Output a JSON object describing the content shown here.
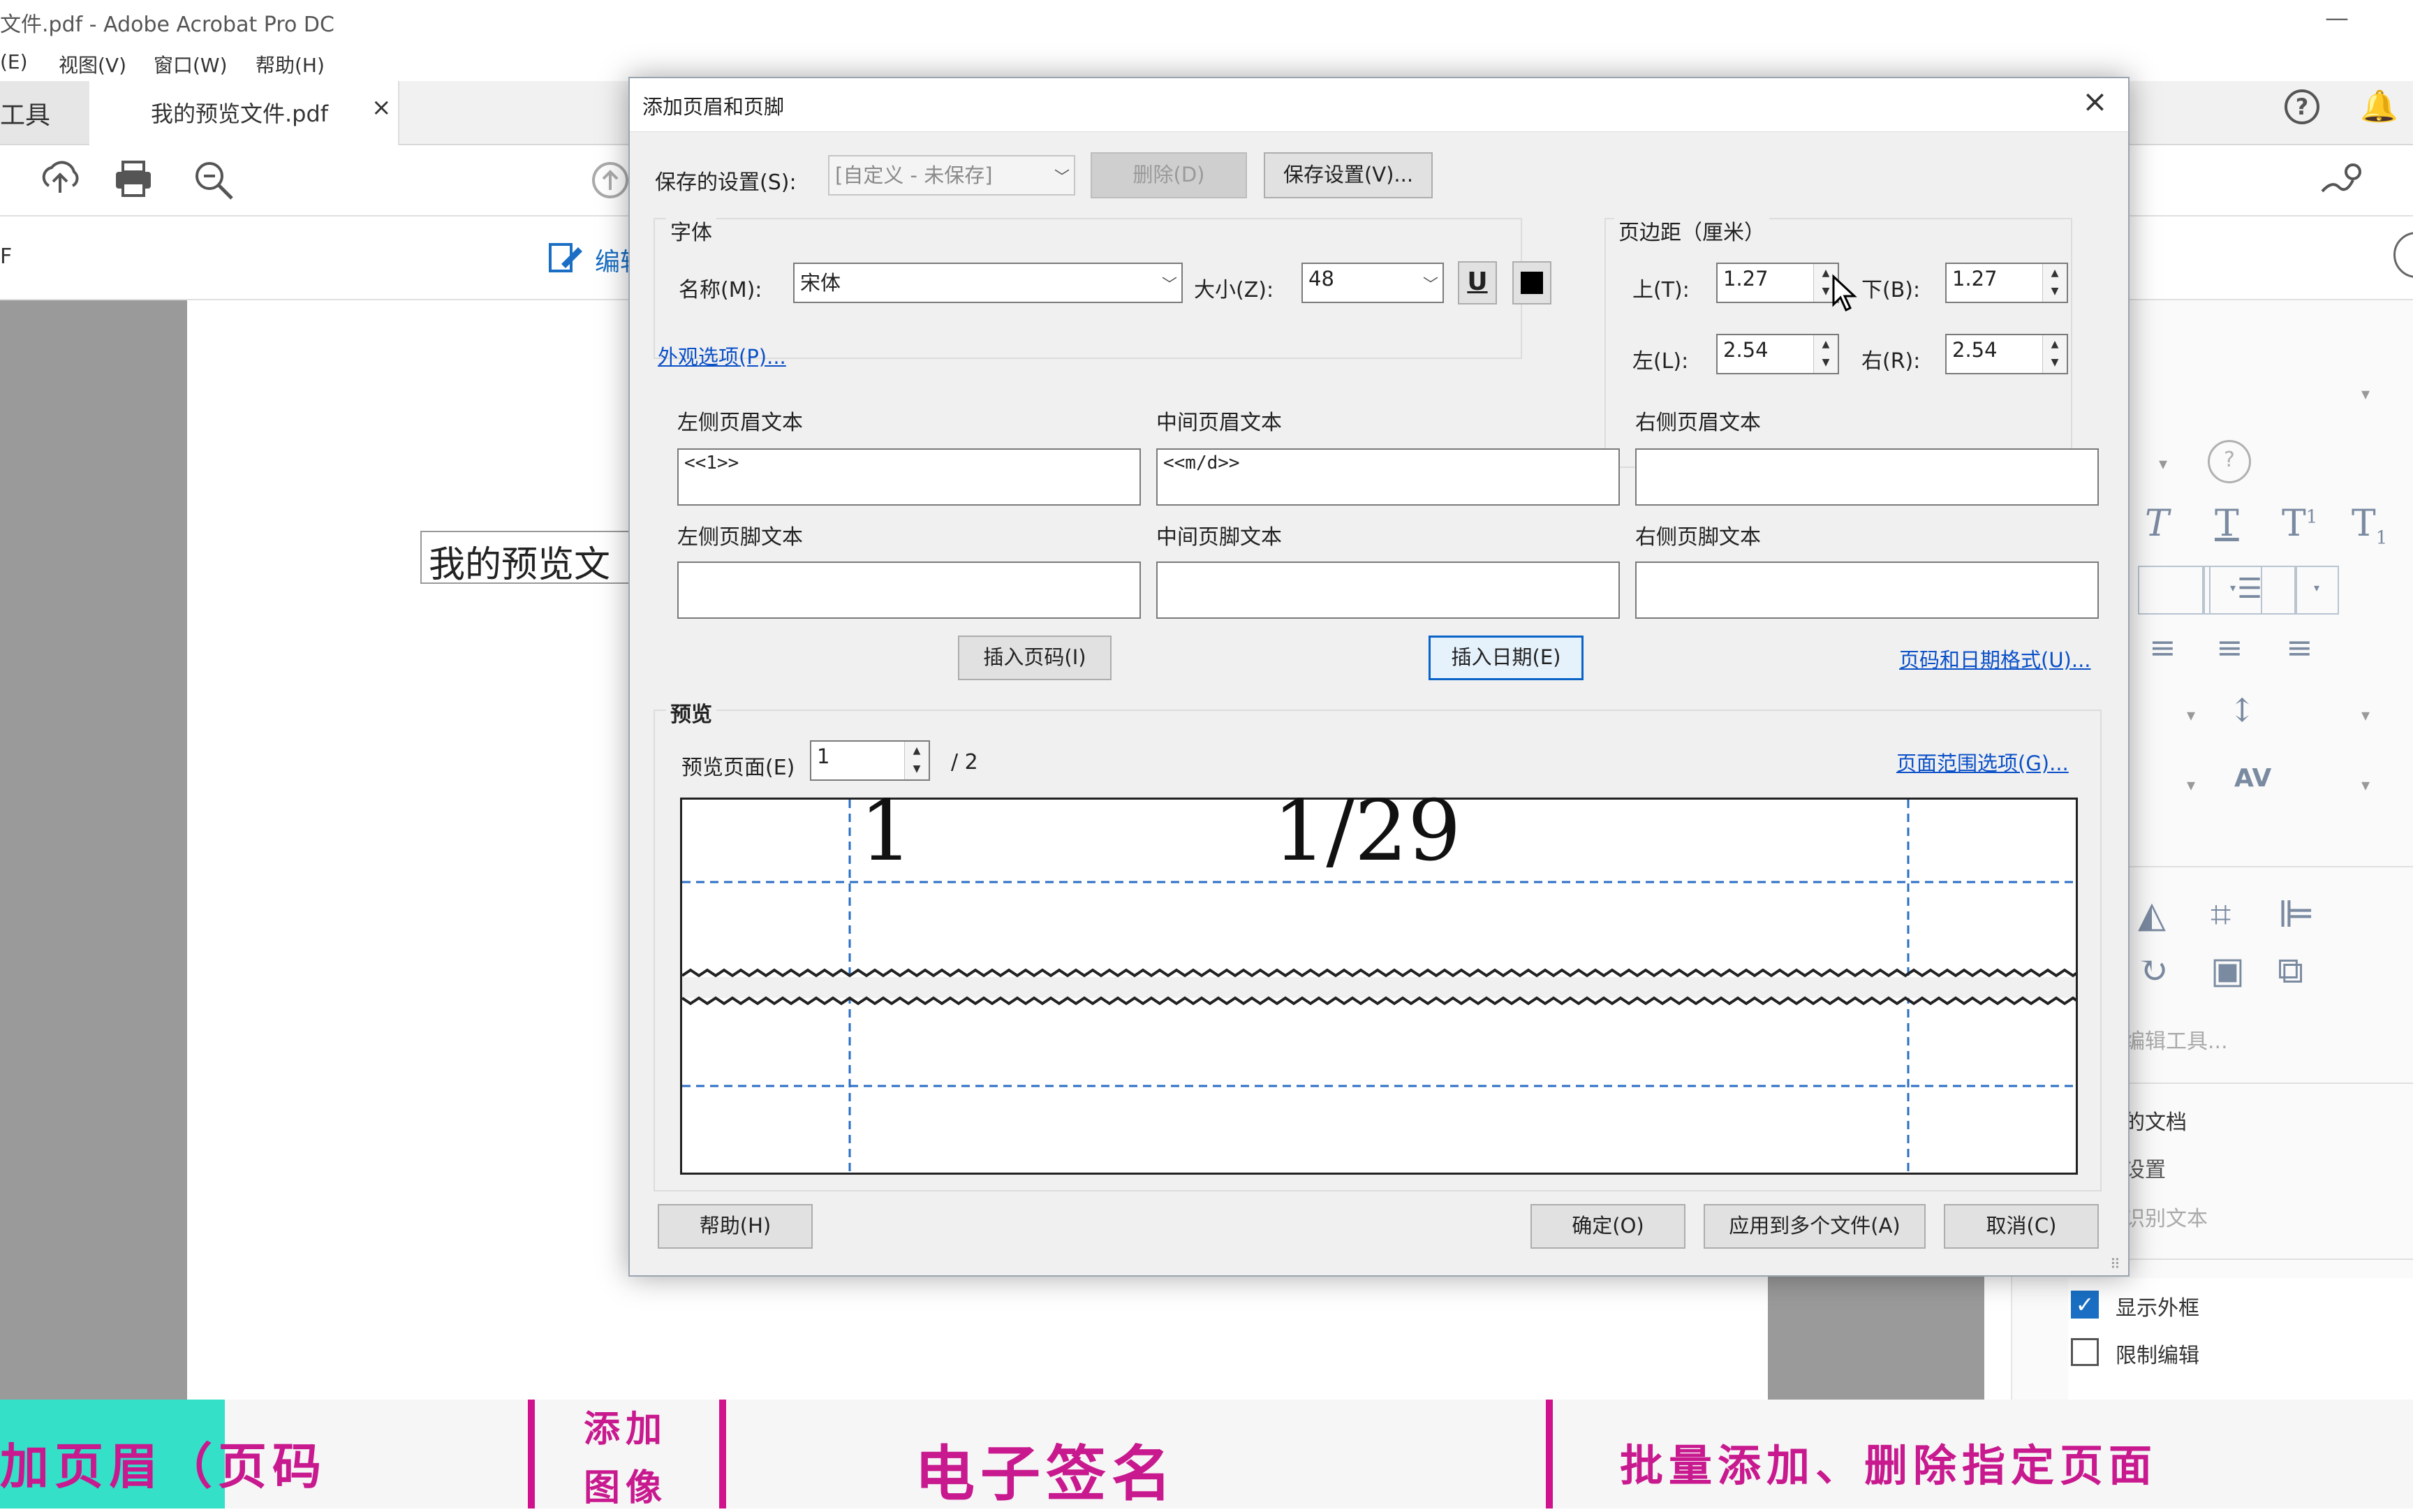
{
  "app": {
    "title": "文件.pdf - Adobe Acrobat Pro DC",
    "menu": [
      "(E)",
      "视图(V)",
      "窗口(W)",
      "帮助(H)"
    ],
    "tab_tools_label": "工具",
    "tab_doc_label": "我的预览文件.pdf",
    "tab_close": "×",
    "edit_label": "编辑",
    "left_edge_label": "F",
    "page_text": "我的预览文"
  },
  "dialog": {
    "title": "添加页眉和页脚",
    "saved_settings_label": "保存的设置(S):",
    "saved_settings_value": "[自定义 - 未保存]",
    "delete_button": "删除(D)",
    "save_settings_button": "保存设置(V)...",
    "font_group": "字体",
    "font_name_label": "名称(M):",
    "font_name_value": "宋体",
    "font_size_label": "大小(Z):",
    "font_size_value": "48",
    "underline_label": "U",
    "margin_group": "页边距（厘米）",
    "margin_top_label": "上(T):",
    "margin_top_value": "1.27",
    "margin_bottom_label": "下(B):",
    "margin_bottom_value": "1.27",
    "margin_left_label": "左(L):",
    "margin_left_value": "2.54",
    "margin_right_label": "右(R):",
    "margin_right_value": "2.54",
    "appearance_link": "外观选项(P)...",
    "left_header_label": "左侧页眉文本",
    "left_header_value": "<<1>>",
    "center_header_label": "中间页眉文本",
    "center_header_value": "<<m/d>>",
    "right_header_label": "右侧页眉文本",
    "right_header_value": "",
    "left_footer_label": "左侧页脚文本",
    "center_footer_label": "中间页脚文本",
    "right_footer_label": "右侧页脚文本",
    "insert_page_button": "插入页码(I)",
    "insert_date_button": "插入日期(E)",
    "page_date_format_link": "页码和日期格式(U)...",
    "preview_group": "预览",
    "preview_page_label": "预览页面(E)",
    "preview_page_value": "1",
    "preview_total": "/ 2",
    "page_range_link": "页面范围选项(G)...",
    "preview_left_text": "1",
    "preview_center_text": "1/29",
    "help_button": "帮助(H)",
    "ok_button": "确定(O)",
    "apply_multi_button": "应用到多个文件(A)",
    "cancel_button": "取消(C)",
    "close_icon": "×"
  },
  "right_panel": {
    "edit_tools": "编辑工具...",
    "doc_section": "的文档",
    "setting": "设置",
    "recognize_text": "识别文本",
    "show_border": "显示外框",
    "show_border_checked": true,
    "restrict_edit": "限制编辑",
    "restrict_edit_checked": false
  },
  "banner": {
    "item1": "加页眉（页码",
    "item2_line1": "添加",
    "item2_line2": "图像",
    "item3": "电子签名",
    "item4": "批量添加、删除指定页面",
    "accent_color": "#c8198f",
    "highlight_color": "#34e0c8"
  }
}
